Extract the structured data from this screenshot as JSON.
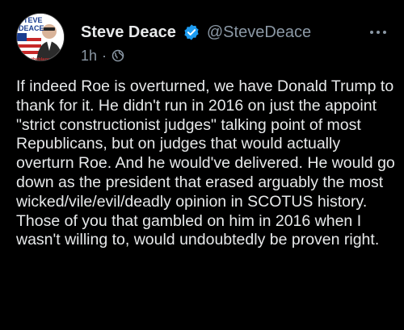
{
  "tweet": {
    "author_name": "Steve Deace",
    "handle": "@SteveDeace",
    "time": "1h",
    "separator": "·",
    "avatar_text": {
      "line1": "STEVE",
      "line2": "DEACE",
      "brand": "theblaze"
    },
    "body": "If indeed Roe is overturned, we have Donald Trump to thank for it. He didn't run in 2016 on just the appoint \"strict constructionist judges\" talking point of most Republicans, but on judges that would actually overturn Roe. And he would've delivered. He would go down as the president that erased arguably the most wicked/vile/evil/deadly opinion in SCOTUS history. Those of you that gambled on him in 2016 when I wasn't willing to, would undoubtedly be proven right.",
    "icons": {
      "verified": "verified-badge-icon",
      "visibility": "globe-icon",
      "more": "more-options-icon"
    },
    "colors": {
      "background": "#000000",
      "text": "#e7e9ea",
      "secondary_text": "#8b98a5",
      "verified": "#1d9bf0",
      "avatar_red": "#c62828",
      "avatar_blue": "#1a3d8f"
    }
  }
}
